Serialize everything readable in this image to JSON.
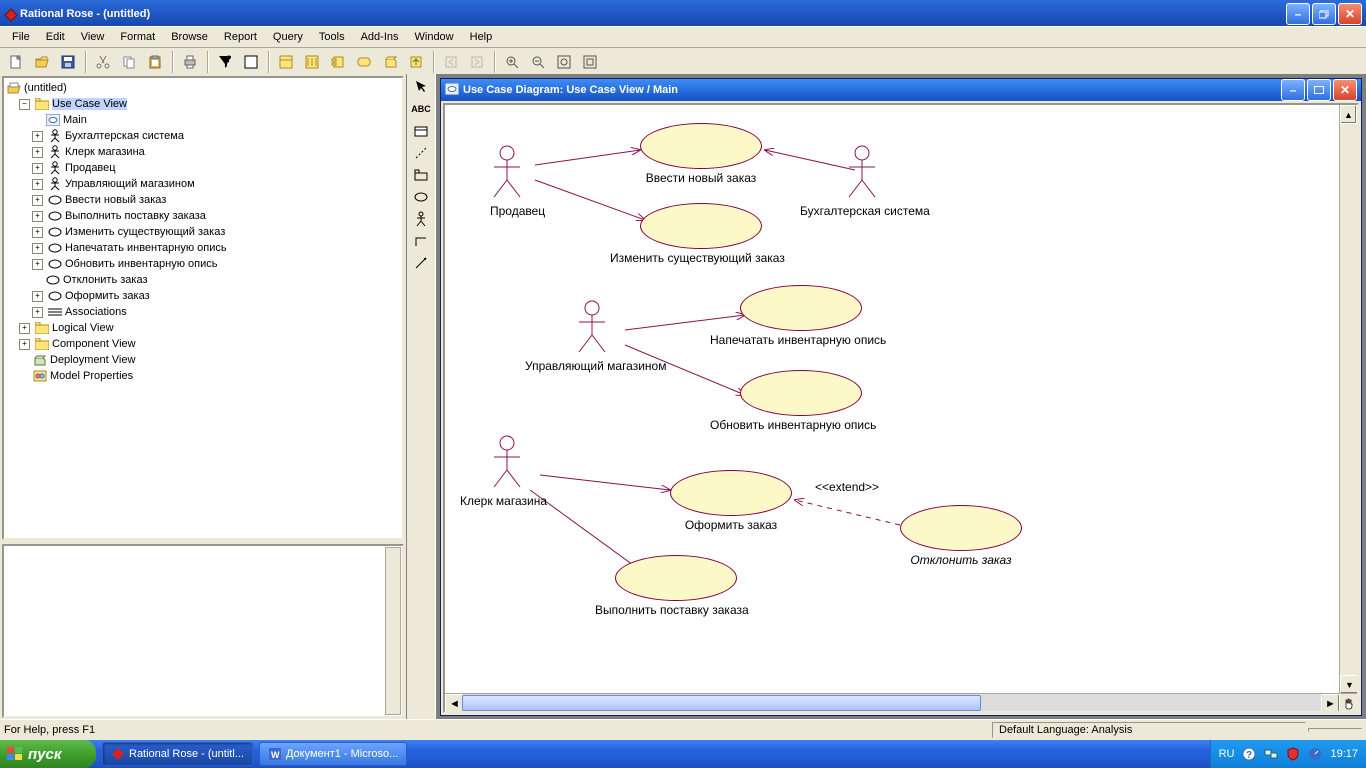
{
  "window": {
    "title": "Rational Rose  -  (untitled)"
  },
  "menu": [
    "File",
    "Edit",
    "View",
    "Format",
    "Browse",
    "Report",
    "Query",
    "Tools",
    "Add-Ins",
    "Window",
    "Help"
  ],
  "tree": {
    "root": "(untitled)",
    "views": {
      "usecase": "Use Case View",
      "logical": "Logical View",
      "component": "Component View",
      "deployment": "Deployment View",
      "model_props": "Model Properties"
    },
    "uc_children": [
      {
        "icon": "diagram",
        "label": "Main"
      },
      {
        "icon": "actor",
        "label": "Бухгалтерская система"
      },
      {
        "icon": "actor",
        "label": "Клерк магазина"
      },
      {
        "icon": "actor",
        "label": "Продавец"
      },
      {
        "icon": "actor",
        "label": "Управляющий магазином"
      },
      {
        "icon": "usecase",
        "label": "Ввести новый заказ"
      },
      {
        "icon": "usecase",
        "label": "Выполнить поставку заказа"
      },
      {
        "icon": "usecase",
        "label": "Изменить существующий заказ"
      },
      {
        "icon": "usecase",
        "label": "Напечатать инвентарную опись"
      },
      {
        "icon": "usecase",
        "label": "Обновить инвентарную опись"
      },
      {
        "icon": "usecase",
        "label": "Отклонить заказ"
      },
      {
        "icon": "usecase",
        "label": "Оформить заказ"
      },
      {
        "icon": "assoc",
        "label": "Associations"
      }
    ]
  },
  "palette_text": "ABC",
  "mdi": {
    "title": "Use Case Diagram: Use Case View / Main"
  },
  "diagram": {
    "actors": {
      "seller": "Продавец",
      "accounting": "Бухгалтерская система",
      "manager": "Управляющий магазином",
      "clerk": "Клерк магазина"
    },
    "usecases": {
      "new_order": "Ввести новый заказ",
      "change_order": "Изменить существующий заказ",
      "print_inv": "Напечатать инвентарную опись",
      "update_inv": "Обновить инвентарную опись",
      "make_order": "Оформить заказ",
      "reject_order": "Отклонить заказ",
      "deliver_order": "Выполнить поставку заказа"
    },
    "stereotype_extend": "<<extend>>"
  },
  "statusbar": {
    "help": "For Help, press F1",
    "lang": "Default Language: Analysis"
  },
  "taskbar": {
    "start": "пуск",
    "tasks": [
      "Rational Rose - (untitl...",
      "Документ1 - Microso..."
    ],
    "lang": "RU",
    "clock": "19:17"
  }
}
